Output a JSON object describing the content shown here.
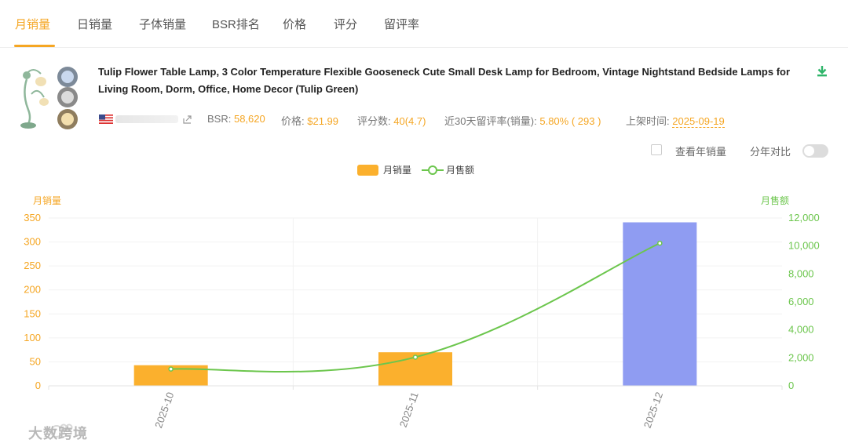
{
  "tabs": [
    {
      "label": "月销量",
      "active": true
    },
    {
      "label": "日销量"
    },
    {
      "label": "子体销量"
    },
    {
      "label": "BSR排名"
    },
    {
      "label": "价格"
    },
    {
      "label": "评分"
    },
    {
      "label": "留评率"
    }
  ],
  "product": {
    "title": "Tulip Flower Table Lamp, 3 Color Temperature Flexible Gooseneck Cute Small Desk Lamp for Bedroom, Vintage Nightstand Bedside Lamps for Living Room, Dorm, Office, Home Decor (Tulip Green)",
    "bsr_label": "BSR:",
    "bsr_value": "58,620",
    "price_label": "价格:",
    "price_value": "$21.99",
    "rating_label": "评分数:",
    "rating_value": "40(4.7)",
    "review_rate_label": "近30天留评率(销量):",
    "review_rate_value": "5.80% ( 293 )",
    "listed_label": "上架时间:",
    "listed_value": "2025-09-19"
  },
  "options": {
    "yearly_label": "查看年销量",
    "compare_label": "分年对比",
    "yearly_checked": false,
    "compare_on": false
  },
  "colors": {
    "accent": "#f5a623",
    "bar": "#fbb02d",
    "bar_highlight": "#8f9cf2",
    "line": "#6cc64d",
    "download": "#2fb56a"
  },
  "icons": {
    "download": "download-icon",
    "share": "share-icon",
    "flag": "us-flag-icon"
  },
  "watermark": "大数跨境",
  "chart_data": {
    "type": "bar",
    "categories": [
      "2025-10",
      "2025-11",
      "2025-12"
    ],
    "series": [
      {
        "name": "月销量",
        "type": "bar",
        "axis": "left",
        "values": [
          43,
          70,
          341
        ]
      },
      {
        "name": "月售额",
        "type": "line",
        "axis": "right",
        "values": [
          1200,
          2050,
          10200
        ]
      }
    ],
    "highlighted_category": "2025-12",
    "ylabel_left": "月销量",
    "ylabel_right": "月售额",
    "ylim_left": [
      0,
      350
    ],
    "ylim_right": [
      0,
      12000
    ],
    "yticks_left": [
      "0",
      "50",
      "100",
      "150",
      "200",
      "250",
      "300",
      "350"
    ],
    "yticks_right": [
      "0",
      "2,000",
      "4,000",
      "6,000",
      "8,000",
      "10,000",
      "12,000"
    ],
    "grid": true,
    "legend_position": "top-center"
  }
}
